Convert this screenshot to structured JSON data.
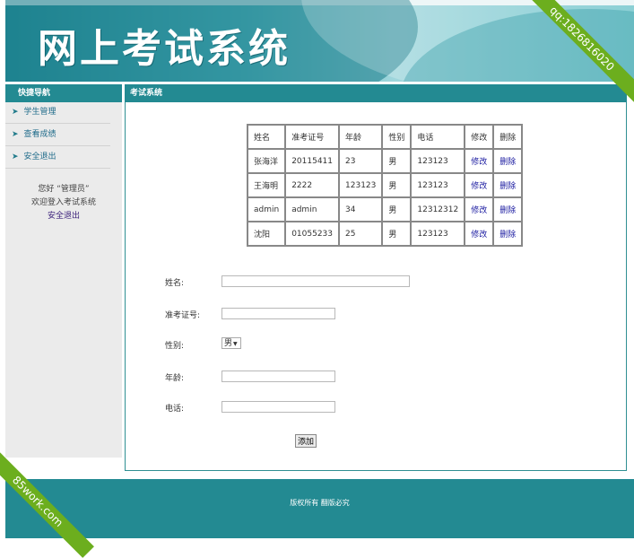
{
  "header": {
    "title": "网上考试系统"
  },
  "sidebar": {
    "heading": "快捷导航",
    "items": [
      {
        "label": "学生管理",
        "icon": "arrow-right-icon"
      },
      {
        "label": "查看成绩",
        "icon": "arrow-right-icon"
      },
      {
        "label": "安全退出",
        "icon": "arrow-right-icon"
      }
    ],
    "greeting": "您好 “管理员”",
    "welcome": "欢迎登入考试系统",
    "logout": "安全退出"
  },
  "main": {
    "heading": "考试系统",
    "table": {
      "headers": [
        "姓名",
        "准考证号",
        "年龄",
        "性别",
        "电话",
        "修改",
        "删除"
      ],
      "rows": [
        [
          "张海洋",
          "20115411",
          "23",
          "男",
          "123123",
          "修改",
          "删除"
        ],
        [
          "王海明",
          "2222",
          "123123",
          "男",
          "123123",
          "修改",
          "删除"
        ],
        [
          "admin",
          "admin",
          "34",
          "男",
          "12312312",
          "修改",
          "删除"
        ],
        [
          "沈阳",
          "01055233",
          "25",
          "男",
          "123123",
          "修改",
          "删除"
        ]
      ]
    },
    "form": {
      "name_label": "姓名:",
      "name_value": "",
      "exam_id_label": "准考证号:",
      "exam_id_value": "",
      "gender_label": "性别:",
      "gender_selected": "男",
      "age_label": "年龄:",
      "age_value": "",
      "phone_label": "电话:",
      "phone_value": "",
      "submit_label": "添加"
    }
  },
  "footer": {
    "copyright": "版权所有 翻版必究"
  },
  "watermarks": {
    "top_right": "qq:1826816020",
    "bottom_left": "85work.com"
  },
  "colors": {
    "accent": "#238a92",
    "ribbon": "#6cae1e",
    "link": "#1a1aa0"
  }
}
